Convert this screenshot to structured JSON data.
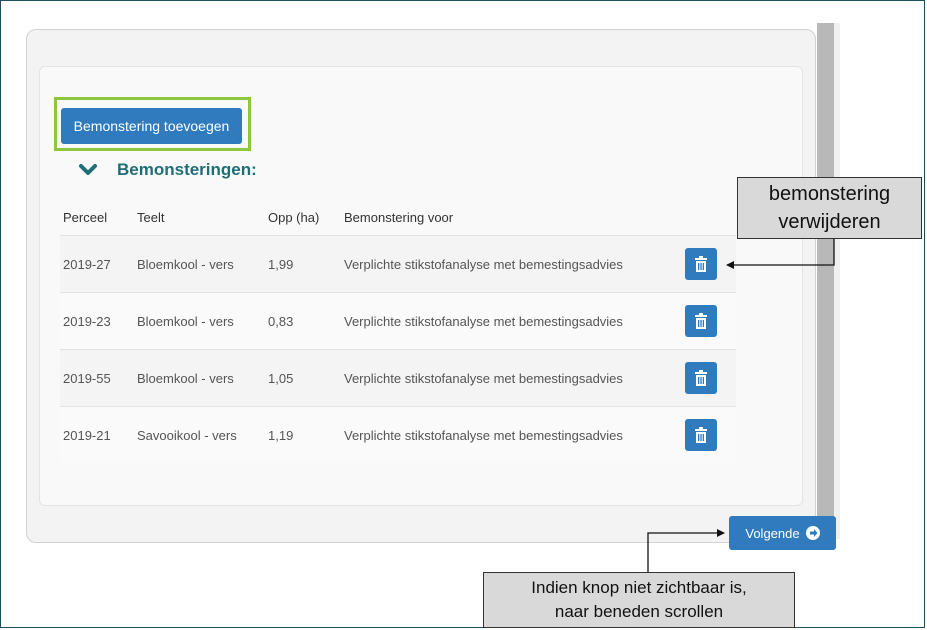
{
  "add_button_label": "Bemonstering toevoegen",
  "section_title": "Bemonsteringen:",
  "table": {
    "headers": [
      "Perceel",
      "Teelt",
      "Opp (ha)",
      "Bemonstering voor"
    ],
    "rows": [
      {
        "perceel": "2019-27",
        "teelt": "Bloemkool - vers",
        "opp": "1,99",
        "bemonstering": "Verplichte stikstofanalyse met bemestingsadvies"
      },
      {
        "perceel": "2019-23",
        "teelt": "Bloemkool - vers",
        "opp": "0,83",
        "bemonstering": "Verplichte stikstofanalyse met bemestingsadvies"
      },
      {
        "perceel": "2019-55",
        "teelt": "Bloemkool - vers",
        "opp": "1,05",
        "bemonstering": "Verplichte stikstofanalyse met bemestingsadvies"
      },
      {
        "perceel": "2019-21",
        "teelt": "Savooikool - vers",
        "opp": "1,19",
        "bemonstering": "Verplichte stikstofanalyse met bemestingsadvies"
      }
    ]
  },
  "next_button_label": "Volgende",
  "annotations": {
    "delete_line1": "bemonstering",
    "delete_line2": "verwijderen",
    "scroll_line1": "Indien knop niet zichtbaar is,",
    "scroll_line2": "naar beneden scrollen"
  },
  "colors": {
    "primary": "#2f7bbd",
    "heading": "#1f6e75",
    "highlight": "#8cc63f"
  },
  "icons": {
    "section_toggle": "chevron-down-icon",
    "delete": "trash-icon",
    "next": "arrow-right-circle-icon"
  }
}
